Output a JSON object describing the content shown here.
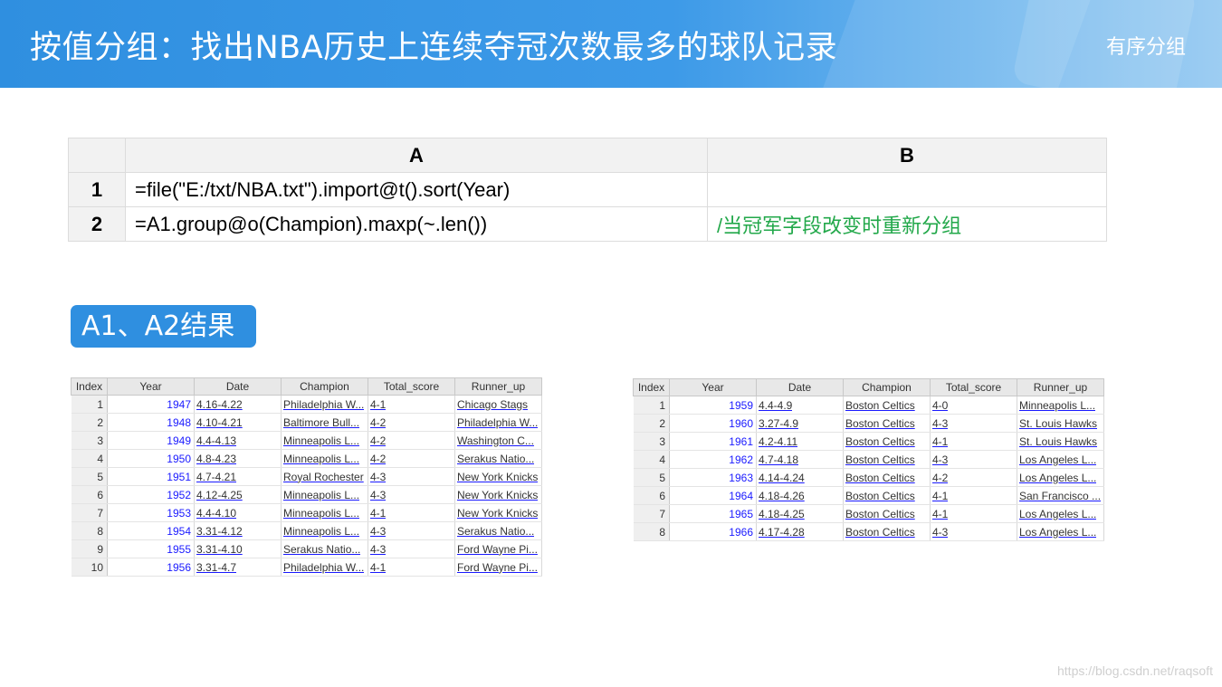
{
  "header": {
    "title": "按值分组：找出NBA历史上连续夺冠次数最多的球队记录",
    "tag": "有序分组"
  },
  "grid": {
    "columns": [
      "A",
      "B"
    ],
    "rows": [
      {
        "num": "1",
        "a": "=file(\"E:/txt/NBA.txt\").import@t().sort(Year)",
        "b": ""
      },
      {
        "num": "2",
        "a": "=A1.group@o(Champion).maxp(~.len())",
        "b": "/当冠军字段改变时重新分组"
      }
    ]
  },
  "badge": "A1、A2结果",
  "tables": {
    "headers": [
      "Index",
      "Year",
      "Date",
      "Champion",
      "Total_score",
      "Runner_up"
    ],
    "left": [
      [
        "1",
        "1947",
        "4.16-4.22",
        "Philadelphia W...",
        "4-1",
        "Chicago Stags"
      ],
      [
        "2",
        "1948",
        "4.10-4.21",
        "Baltimore Bull...",
        "4-2",
        "Philadelphia W..."
      ],
      [
        "3",
        "1949",
        "4.4-4.13",
        "Minneapolis L...",
        "4-2",
        "Washington C..."
      ],
      [
        "4",
        "1950",
        "4.8-4.23",
        "Minneapolis L...",
        "4-2",
        "Serakus Natio..."
      ],
      [
        "5",
        "1951",
        "4.7-4.21",
        "Royal Rochester",
        "4-3",
        "New York Knicks"
      ],
      [
        "6",
        "1952",
        "4.12-4.25",
        "Minneapolis L...",
        "4-3",
        "New York Knicks"
      ],
      [
        "7",
        "1953",
        "4.4-4.10",
        "Minneapolis L...",
        "4-1",
        "New York Knicks"
      ],
      [
        "8",
        "1954",
        "3.31-4.12",
        "Minneapolis L...",
        "4-3",
        "Serakus Natio..."
      ],
      [
        "9",
        "1955",
        "3.31-4.10",
        "Serakus Natio...",
        "4-3",
        "Ford Wayne Pi..."
      ],
      [
        "10",
        "1956",
        "3.31-4.7",
        "Philadelphia W...",
        "4-1",
        "Ford Wayne Pi..."
      ]
    ],
    "right": [
      [
        "1",
        "1959",
        "4.4-4.9",
        "Boston Celtics",
        "4-0",
        "Minneapolis L..."
      ],
      [
        "2",
        "1960",
        "3.27-4.9",
        "Boston Celtics",
        "4-3",
        "St. Louis Hawks"
      ],
      [
        "3",
        "1961",
        "4.2-4.11",
        "Boston Celtics",
        "4-1",
        "St. Louis Hawks"
      ],
      [
        "4",
        "1962",
        "4.7-4.18",
        "Boston Celtics",
        "4-3",
        "Los Angeles L..."
      ],
      [
        "5",
        "1963",
        "4.14-4.24",
        "Boston Celtics",
        "4-2",
        "Los Angeles L..."
      ],
      [
        "6",
        "1964",
        "4.18-4.26",
        "Boston Celtics",
        "4-1",
        "San Francisco ..."
      ],
      [
        "7",
        "1965",
        "4.18-4.25",
        "Boston Celtics",
        "4-1",
        "Los Angeles L..."
      ],
      [
        "8",
        "1966",
        "4.17-4.28",
        "Boston Celtics",
        "4-3",
        "Los Angeles L..."
      ]
    ]
  },
  "watermark": "https://blog.csdn.net/raqsoft"
}
